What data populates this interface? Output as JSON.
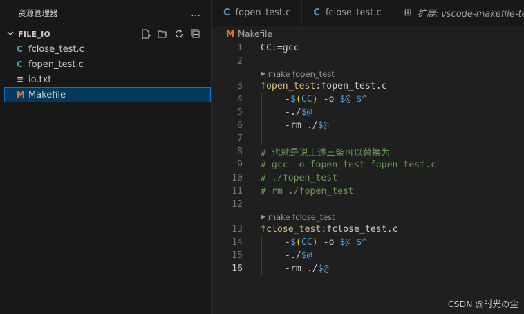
{
  "sidebar": {
    "title": "资源管理器",
    "more_icon": "…",
    "folder": {
      "name": "FILE_IO"
    },
    "files": [
      {
        "name": "fclose_test.c",
        "icon": "C"
      },
      {
        "name": "fopen_test.c",
        "icon": "C"
      },
      {
        "name": "io.txt",
        "icon": "≡"
      },
      {
        "name": "Makefile",
        "icon": "M"
      }
    ]
  },
  "tabs": [
    {
      "label": "fopen_test.c",
      "icon": "C"
    },
    {
      "label": "fclose_test.c",
      "icon": "C"
    },
    {
      "label": "扩展: vscode-makefile-term",
      "icon": "⊞"
    }
  ],
  "breadcrumb": {
    "file": "Makefile",
    "icon": "M"
  },
  "codelens": [
    "make fopen_test",
    "make fclose_test"
  ],
  "lines": {
    "n1": "1",
    "n2": "2",
    "n3": "3",
    "n4": "4",
    "n5": "5",
    "n6": "6",
    "n7": "7",
    "n8": "8",
    "n9": "9",
    "n10": "10",
    "n11": "11",
    "n12": "12",
    "n13": "13",
    "n14": "14",
    "n15": "15",
    "n16": "16",
    "l1": "CC:=gcc",
    "l3_target": "fopen_test",
    "l3_colon": ":",
    "l3_dep": "fopen_test.c",
    "l8": "# 也就是说上述三条可以替换为",
    "l9": "# gcc -o fopen_test fopen_test.c",
    "l10": "# ./fopen_test",
    "l11": "# rm ./fopen_test",
    "l13_target": "fclose_test",
    "l13_colon": ":",
    "l13_dep": "fclose_test.c"
  },
  "watermark": "CSDN @时光の尘",
  "colors": {
    "accent": "#0078d4",
    "c_icon": "#519aba",
    "makefile_icon": "#e37933"
  }
}
